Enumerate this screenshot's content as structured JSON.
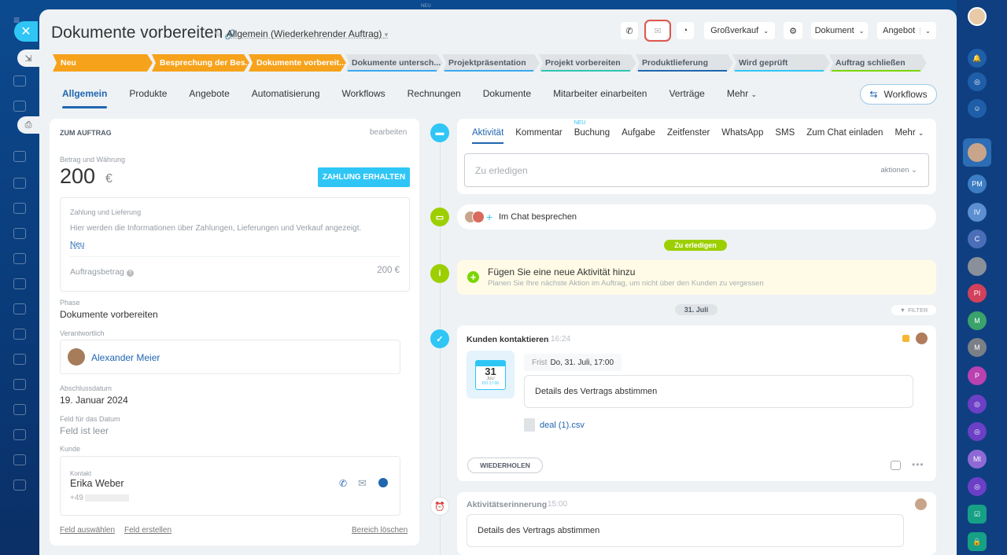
{
  "window": {
    "top_label": "NEU"
  },
  "deal": {
    "title": "Dokumente vorbereiten",
    "pipeline": "Allgemein (Wiederkehrender Auftrag)"
  },
  "toolbar": {
    "sales_type": "Großverkauf",
    "document": "Dokument",
    "offer": "Angebot"
  },
  "stages": [
    {
      "label": "Neu",
      "state": "active",
      "color": "#f7a21b"
    },
    {
      "label": "Besprechung der Bes...",
      "state": "active",
      "color": "#f7a21b"
    },
    {
      "label": "Dokumente vorbereit...",
      "state": "active",
      "color": "#f7a21b"
    },
    {
      "label": "Dokumente untersch...",
      "state": "pending",
      "color": "#39a8ef"
    },
    {
      "label": "Projektpräsentation",
      "state": "pending",
      "color": "#39a8ef"
    },
    {
      "label": "Projekt vorbereiten",
      "state": "pending",
      "color": "#2fc6b0"
    },
    {
      "label": "Produktlieferung",
      "state": "pending",
      "color": "#2066b0"
    },
    {
      "label": "Wird geprüft",
      "state": "pending",
      "color": "#2fc6f6"
    },
    {
      "label": "Auftrag schließen",
      "state": "pending",
      "color": "#7bd500"
    }
  ],
  "tabs": [
    "Allgemein",
    "Produkte",
    "Angebote",
    "Automatisierung",
    "Workflows",
    "Rechnungen",
    "Dokumente",
    "Mitarbeiter einarbeiten",
    "Verträge",
    "Mehr"
  ],
  "workflows_button": "Workflows",
  "left_card": {
    "header": "ZUM AUFTRAG",
    "edit": "bearbeiten",
    "amount_label": "Betrag und Währung",
    "amount": "200",
    "currency": "€",
    "payment_button": "ZAHLUNG ERHALTEN",
    "payment_label": "Zahlung und Lieferung",
    "payment_info": "Hier werden die Informationen über Zahlungen, Lieferungen und Verkauf angezeigt.",
    "payment_new": "Neu",
    "order_amount_label": "Auftragsbetrag",
    "order_amount": "200 €",
    "phase_label": "Phase",
    "phase": "Dokumente vorbereiten",
    "responsible_label": "Verantwortlich",
    "responsible": "Alexander Meier",
    "close_date_label": "Abschlussdatum",
    "close_date": "19. Januar 2024",
    "date_field_label": "Feld für das Datum",
    "date_field": "Feld ist leer",
    "client_label": "Kunde",
    "contact_label": "Kontakt",
    "contact_name": "Erika Weber",
    "contact_phone": "+49",
    "select_field": "Feld auswählen",
    "create_field": "Feld erstellen",
    "clear_area": "Bereich löschen"
  },
  "timeline": {
    "tabs": [
      "Aktivität",
      "Kommentar",
      "Buchung",
      "Aufgabe",
      "Zeitfenster",
      "WhatsApp",
      "SMS",
      "Zum Chat einladen",
      "Mehr"
    ],
    "new_badge": "NEU",
    "todo_placeholder": "Zu erledigen",
    "actions": "aktionen",
    "chat_discuss": "Im Chat besprechen",
    "todo_pill": "Zu erledigen",
    "hint_title": "Fügen Sie eine neue Aktivität hinzu",
    "hint_text": "Planen Sie Ihre nächste Aktion im Auftrag, um nicht über den Kunden zu vergessen",
    "date_pill": "31. Juli",
    "filter": "FILTER",
    "activity": {
      "title": "Kunden kontaktieren",
      "time": "16:24",
      "cal_day": "31",
      "cal_month": "JULI",
      "cal_sub": "DO 17:00",
      "deadline_label": "Frist",
      "deadline": "Do, 31. Juli, 17:00",
      "description": "Details des Vertrags abstimmen",
      "file": "deal (1).csv",
      "repeat": "WIEDERHOLEN"
    },
    "reminder": {
      "title": "Aktivitätserinnerung",
      "time": "15:00",
      "description": "Details des Vertrags abstimmen"
    }
  },
  "rightnav": {
    "initials": [
      "PM",
      "IV",
      "C",
      "PI",
      "M",
      "M",
      "P",
      "MI"
    ]
  }
}
